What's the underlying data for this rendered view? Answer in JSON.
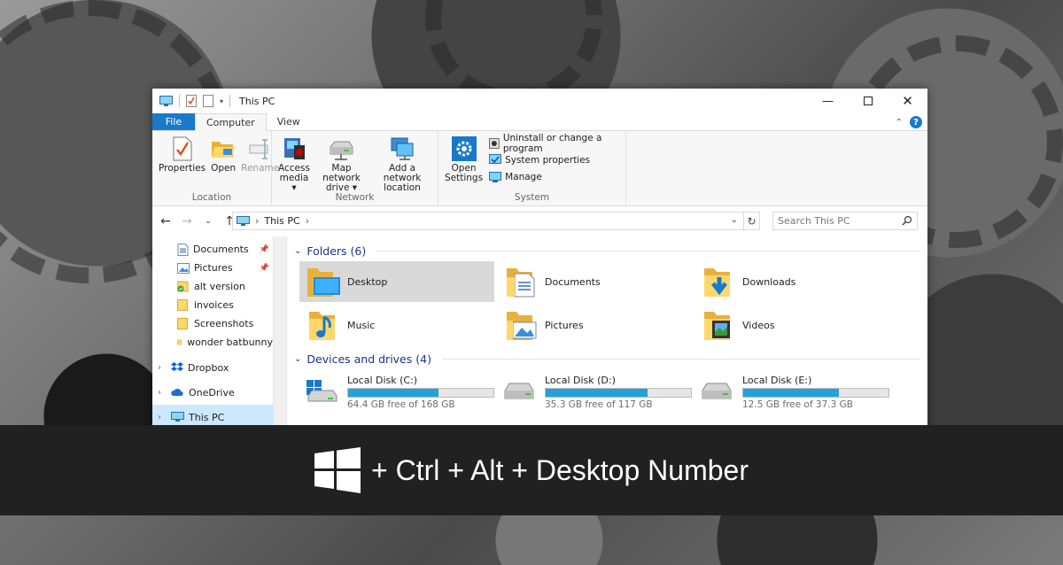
{
  "window": {
    "title": "This PC",
    "controls": [
      "minimize",
      "maximize",
      "close"
    ]
  },
  "ribbon_tabs": {
    "file": "File",
    "computer": "Computer",
    "view": "View"
  },
  "ribbon": {
    "location": {
      "label": "Location",
      "properties": "Properties",
      "open": "Open",
      "rename": "Rename"
    },
    "network": {
      "label": "Network",
      "access_media_1": "Access",
      "access_media_2": "media",
      "map_drive_1": "Map network",
      "map_drive_2": "drive",
      "add_location_1": "Add a network",
      "add_location_2": "location"
    },
    "system": {
      "label": "System",
      "open_settings_1": "Open",
      "open_settings_2": "Settings",
      "uninstall": "Uninstall or change a program",
      "system_properties": "System properties",
      "manage": "Manage"
    }
  },
  "address": {
    "path": "This PC",
    "search_placeholder": "Search This PC"
  },
  "nav": {
    "quick_access": [
      {
        "label": "Documents",
        "pinned": true
      },
      {
        "label": "Pictures",
        "pinned": true
      },
      {
        "label": "alt version",
        "pinned": false
      },
      {
        "label": "invoices",
        "pinned": false
      },
      {
        "label": "Screenshots",
        "pinned": false
      },
      {
        "label": "wonder batbunny",
        "pinned": false
      }
    ],
    "dropbox": "Dropbox",
    "onedrive": "OneDrive",
    "thispc": "This PC"
  },
  "folders": {
    "header": "Folders (6)",
    "items": [
      "Desktop",
      "Documents",
      "Downloads",
      "Music",
      "Pictures",
      "Videos"
    ]
  },
  "drives": {
    "header": "Devices and drives (4)",
    "items": [
      {
        "name": "Local Disk (C:)",
        "free": "64.4 GB free of 168 GB",
        "used_fraction": 0.62
      },
      {
        "name": "Local Disk (D:)",
        "free": "35.3 GB free of 117 GB",
        "used_fraction": 0.7
      },
      {
        "name": "Local Disk (E:)",
        "free": "12.5 GB free of 37.3 GB",
        "used_fraction": 0.66
      }
    ]
  },
  "caption": {
    "text": "+ Ctrl + Alt + Desktop Number"
  },
  "colors": {
    "accent": "#1979ca",
    "usage_bar": "#26a0da",
    "caption_bg": "#212121"
  }
}
